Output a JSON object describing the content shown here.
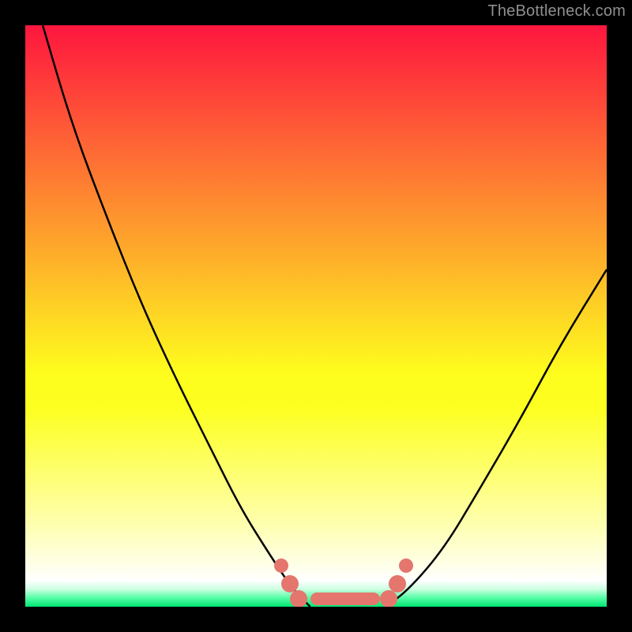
{
  "watermark": "TheBottleneck.com",
  "gradient": {
    "top_color": "#fe163e",
    "mid_color": "#fefd1d",
    "bottom_color": "#00e573"
  },
  "chart_data": {
    "type": "line",
    "title": "",
    "xlabel": "",
    "ylabel": "",
    "xlim": [
      0,
      100
    ],
    "ylim": [
      0,
      100
    ],
    "series": [
      {
        "name": "left-curve",
        "x": [
          3,
          8,
          14,
          20,
          26,
          32,
          37,
          42,
          46,
          49
        ],
        "values": [
          100,
          83,
          67,
          52,
          39,
          27,
          17,
          9,
          3,
          0
        ]
      },
      {
        "name": "right-curve",
        "x": [
          62,
          66,
          72,
          78,
          85,
          92,
          100
        ],
        "values": [
          0,
          3,
          10,
          20,
          32,
          45,
          58
        ]
      }
    ],
    "markers": {
      "name": "bottleneck-band",
      "left_dots_x": [
        44,
        45.5,
        47
      ],
      "flat_segment_x": [
        49,
        61
      ],
      "right_dots_x": [
        62.5,
        64,
        65.5
      ],
      "y": 0
    }
  }
}
